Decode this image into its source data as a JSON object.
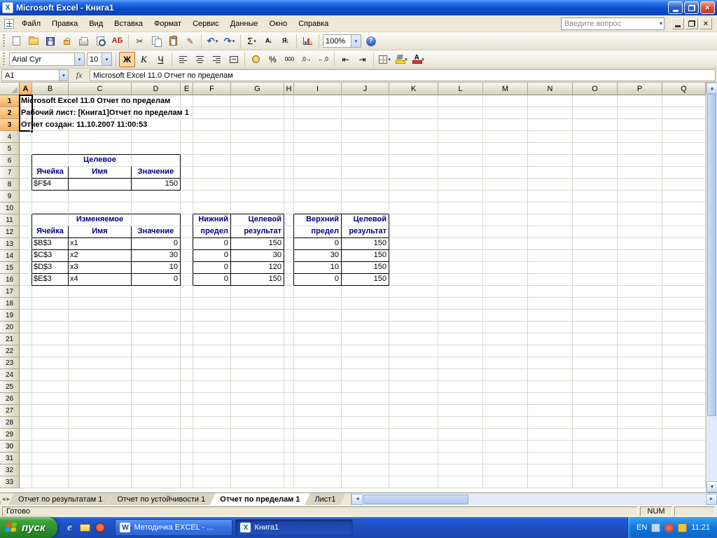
{
  "window": {
    "title": "Microsoft Excel - Книга1"
  },
  "menubar": {
    "items": [
      {
        "label": "Файл",
        "name": "file"
      },
      {
        "label": "Правка",
        "name": "edit"
      },
      {
        "label": "Вид",
        "name": "view"
      },
      {
        "label": "Вставка",
        "name": "insert"
      },
      {
        "label": "Формат",
        "name": "format"
      },
      {
        "label": "Сервис",
        "name": "tools"
      },
      {
        "label": "Данные",
        "name": "data"
      },
      {
        "label": "Окно",
        "name": "window"
      },
      {
        "label": "Справка",
        "name": "help"
      }
    ],
    "question_placeholder": "Введите вопрос"
  },
  "toolbars": {
    "zoom": "100%",
    "standard": [
      {
        "name": "new-button",
        "icon": "doc"
      },
      {
        "name": "open-button",
        "icon": "folder"
      },
      {
        "name": "save-button",
        "icon": "save"
      },
      {
        "name": "permission-button",
        "icon": "lock"
      },
      {
        "name": "print-button",
        "icon": "print"
      },
      {
        "name": "print-preview-button",
        "icon": "preview"
      },
      {
        "name": "spelling-button",
        "icon": "spell",
        "glyph": "АБ"
      },
      {
        "sep": true
      },
      {
        "name": "cut-button",
        "icon": "cut",
        "glyph": "✂"
      },
      {
        "name": "copy-button",
        "icon": "copy"
      },
      {
        "name": "paste-button",
        "icon": "paste"
      },
      {
        "name": "format-painter-button",
        "icon": "painter",
        "glyph": "✎"
      },
      {
        "sep": true
      },
      {
        "name": "undo-button",
        "icon": "undo",
        "glyph": "↶",
        "dd": true
      },
      {
        "name": "redo-button",
        "icon": "redo",
        "glyph": "↷",
        "dd": true
      },
      {
        "sep": true
      },
      {
        "name": "autosum-button",
        "icon": "sum",
        "glyph": "Σ",
        "dd": true
      },
      {
        "name": "sort-ascending-button",
        "icon": "sortaz",
        "glyph": "А↓"
      },
      {
        "name": "sort-descending-button",
        "icon": "sortza",
        "glyph": "Я↓"
      },
      {
        "sep": true
      },
      {
        "name": "chart-wizard-button",
        "icon": "chart"
      },
      {
        "sep": true
      },
      {
        "name": "zoom-combo",
        "zoom": true
      },
      {
        "name": "help-button",
        "icon": "help",
        "glyph": "?"
      }
    ],
    "formatting": {
      "font": "Arial Cyr",
      "size": "10",
      "buttons": [
        {
          "sep": true
        },
        {
          "name": "bold-button",
          "glyph": "Ж",
          "style": "bold",
          "active": true
        },
        {
          "name": "italic-button",
          "glyph": "К",
          "style": "italic"
        },
        {
          "name": "underline-button",
          "glyph": "Ч",
          "style": "underline"
        },
        {
          "sep": true
        },
        {
          "name": "align-left-button",
          "icon": "al"
        },
        {
          "name": "align-center-button",
          "icon": "ac"
        },
        {
          "name": "align-right-button",
          "icon": "ar"
        },
        {
          "name": "merge-center-button",
          "icon": "mc"
        },
        {
          "sep": true
        },
        {
          "name": "currency-style-button",
          "icon": "coin"
        },
        {
          "name": "percent-style-button",
          "glyph": "%"
        },
        {
          "name": "comma-style-button",
          "glyph": "000",
          "small": true
        },
        {
          "name": "increase-decimal-button",
          "glyph": ",0→",
          "small": true
        },
        {
          "name": "decrease-decimal-button",
          "glyph": "←,0",
          "small": true
        },
        {
          "sep": true
        },
        {
          "name": "decrease-indent-button",
          "glyph": "⇤"
        },
        {
          "name": "increase-indent-button",
          "glyph": "⇥"
        },
        {
          "sep": true
        },
        {
          "name": "borders-button",
          "icon": "borders",
          "dd": true
        },
        {
          "name": "fill-color-button",
          "icon": "fill",
          "dd": true
        },
        {
          "name": "font-color-button",
          "icon": "fontcolor",
          "glyph": "А",
          "dd": true
        }
      ]
    }
  },
  "formula_bar": {
    "name_box": "A1",
    "fx_label": "fx",
    "value": "Microsoft Excel 11.0 Отчет по пределам"
  },
  "sheet": {
    "columns": [
      "A",
      "B",
      "C",
      "D",
      "E",
      "F",
      "G",
      "H",
      "I",
      "J",
      "K",
      "L",
      "M",
      "N",
      "O",
      "P",
      "Q"
    ],
    "row_count": 33,
    "selected_col": "A",
    "selected_rows": [
      1,
      2,
      3
    ],
    "cells": [
      {
        "r": 1,
        "c": "A",
        "t": "Microsoft Excel 11.0 Отчет по пределам",
        "f": "b o"
      },
      {
        "r": 2,
        "c": "A",
        "t": "Рабочий лист: [Книга1]Отчет по пределам 1",
        "f": "b o"
      },
      {
        "r": 3,
        "c": "A",
        "t": "Отчет создан: 11.10.2007 11:00:53",
        "f": "b o"
      },
      {
        "r": 6,
        "c": "B",
        "f": "T L"
      },
      {
        "r": 6,
        "c": "C",
        "t": "Целевое",
        "f": "b n c T"
      },
      {
        "r": 6,
        "c": "D",
        "f": "T R"
      },
      {
        "r": 7,
        "c": "B",
        "t": "Ячейка",
        "f": "b n c L B"
      },
      {
        "r": 7,
        "c": "C",
        "t": "Имя",
        "f": "b n c L B"
      },
      {
        "r": 7,
        "c": "D",
        "t": "Значение",
        "f": "b n c L B R"
      },
      {
        "r": 8,
        "c": "B",
        "t": "$F$4",
        "f": "L B"
      },
      {
        "r": 8,
        "c": "C",
        "f": "L B"
      },
      {
        "r": 8,
        "c": "D",
        "t": "150",
        "f": "r L B R"
      },
      {
        "r": 11,
        "c": "B",
        "f": "T L"
      },
      {
        "r": 11,
        "c": "C",
        "t": "Изменяемое",
        "f": "b n c T"
      },
      {
        "r": 11,
        "c": "D",
        "f": "T R"
      },
      {
        "r": 11,
        "c": "F",
        "t": "Нижний",
        "f": "b n r T L"
      },
      {
        "r": 11,
        "c": "G",
        "t": "Целевой",
        "f": "b n r T L R"
      },
      {
        "r": 11,
        "c": "I",
        "t": "Верхний",
        "f": "b n r T L"
      },
      {
        "r": 11,
        "c": "J",
        "t": "Целевой",
        "f": "b n r T L R"
      },
      {
        "r": 12,
        "c": "B",
        "t": "Ячейка",
        "f": "b n c L B"
      },
      {
        "r": 12,
        "c": "C",
        "t": "Имя",
        "f": "b n c L B"
      },
      {
        "r": 12,
        "c": "D",
        "t": "Значение",
        "f": "b n c L B R"
      },
      {
        "r": 12,
        "c": "F",
        "t": "предел",
        "f": "b n r L B"
      },
      {
        "r": 12,
        "c": "G",
        "t": "результат",
        "f": "b n r L B R"
      },
      {
        "r": 12,
        "c": "I",
        "t": "предел",
        "f": "b n r L B"
      },
      {
        "r": 12,
        "c": "J",
        "t": "результат",
        "f": "b n r L B R"
      },
      {
        "r": 13,
        "c": "B",
        "t": "$B$3",
        "f": "L B"
      },
      {
        "r": 13,
        "c": "C",
        "t": "x1",
        "f": "L B"
      },
      {
        "r": 13,
        "c": "D",
        "t": "0",
        "f": "r L B R"
      },
      {
        "r": 13,
        "c": "F",
        "t": "0",
        "f": "r L B"
      },
      {
        "r": 13,
        "c": "G",
        "t": "150",
        "f": "r L B R"
      },
      {
        "r": 13,
        "c": "I",
        "t": "0",
        "f": "r L B"
      },
      {
        "r": 13,
        "c": "J",
        "t": "150",
        "f": "r L B R"
      },
      {
        "r": 14,
        "c": "B",
        "t": "$C$3",
        "f": "L B"
      },
      {
        "r": 14,
        "c": "C",
        "t": "x2",
        "f": "L B"
      },
      {
        "r": 14,
        "c": "D",
        "t": "30",
        "f": "r L B R"
      },
      {
        "r": 14,
        "c": "F",
        "t": "0",
        "f": "r L B"
      },
      {
        "r": 14,
        "c": "G",
        "t": "30",
        "f": "r L B R"
      },
      {
        "r": 14,
        "c": "I",
        "t": "30",
        "f": "r L B"
      },
      {
        "r": 14,
        "c": "J",
        "t": "150",
        "f": "r L B R"
      },
      {
        "r": 15,
        "c": "B",
        "t": "$D$3",
        "f": "L B"
      },
      {
        "r": 15,
        "c": "C",
        "t": "x3",
        "f": "L B"
      },
      {
        "r": 15,
        "c": "D",
        "t": "10",
        "f": "r L B R"
      },
      {
        "r": 15,
        "c": "F",
        "t": "0",
        "f": "r L B"
      },
      {
        "r": 15,
        "c": "G",
        "t": "120",
        "f": "r L B R"
      },
      {
        "r": 15,
        "c": "I",
        "t": "10",
        "f": "r L B"
      },
      {
        "r": 15,
        "c": "J",
        "t": "150",
        "f": "r L B R"
      },
      {
        "r": 16,
        "c": "B",
        "t": "$E$3",
        "f": "L B"
      },
      {
        "r": 16,
        "c": "C",
        "t": "x4",
        "f": "L B"
      },
      {
        "r": 16,
        "c": "D",
        "t": "0",
        "f": "r L B R"
      },
      {
        "r": 16,
        "c": "F",
        "t": "0",
        "f": "r L B"
      },
      {
        "r": 16,
        "c": "G",
        "t": "150",
        "f": "r L B R"
      },
      {
        "r": 16,
        "c": "I",
        "t": "0",
        "f": "r L B"
      },
      {
        "r": 16,
        "c": "J",
        "t": "150",
        "f": "r L B R"
      }
    ]
  },
  "tabs": {
    "nav": [
      "|◄",
      "◄",
      "►",
      "►|"
    ],
    "items": [
      {
        "label": "Отчет по результатам 1",
        "active": false
      },
      {
        "label": "Отчет по устойчивости 1",
        "active": false
      },
      {
        "label": "Отчет по пределам 1",
        "active": true
      },
      {
        "label": "Лист1",
        "active": false
      }
    ]
  },
  "status": {
    "left": "Готово",
    "num": "NUM"
  },
  "taskbar": {
    "start": "пуск",
    "tasks": [
      {
        "label": "Методичка EXCEL - ...",
        "app": "word",
        "icon_letter": "W",
        "pressed": false
      },
      {
        "label": "Книга1",
        "app": "excel",
        "icon_letter": "X",
        "pressed": true
      }
    ],
    "lang": "EN",
    "time": "11:21"
  }
}
